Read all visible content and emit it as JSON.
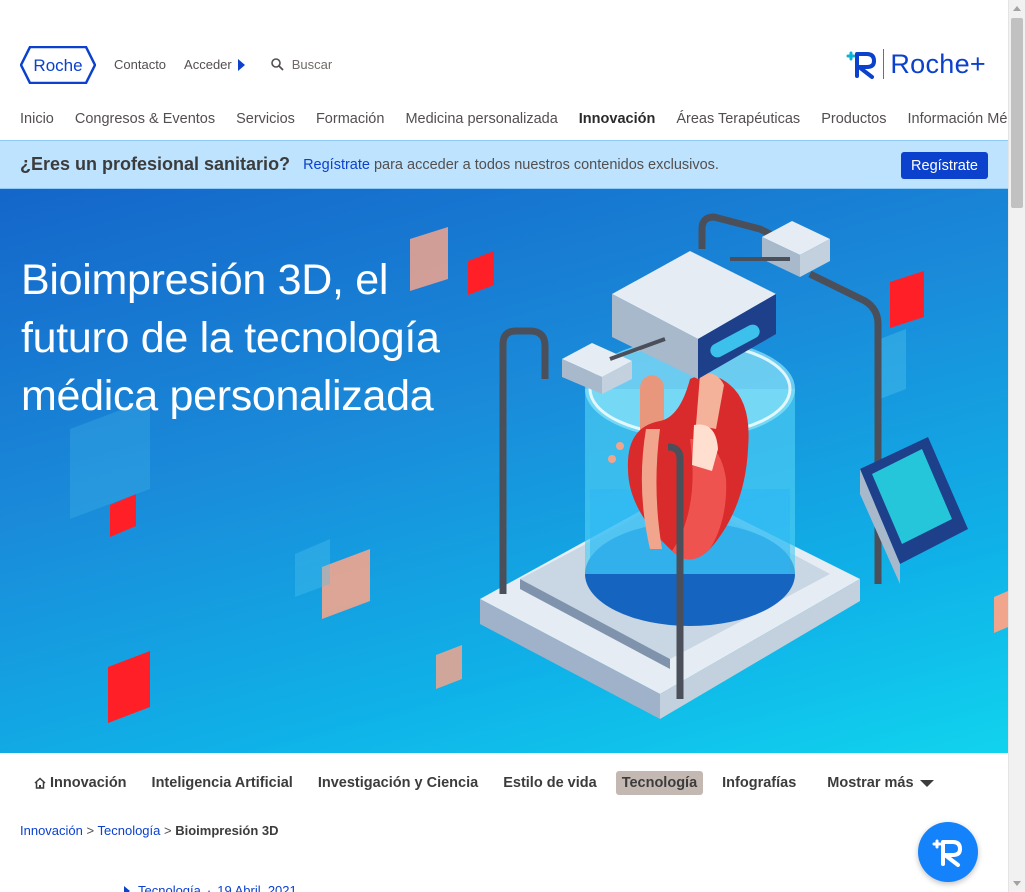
{
  "header": {
    "logo_text": "Roche",
    "links": {
      "contact": "Contacto",
      "login": "Acceder",
      "search": "Buscar"
    },
    "rocheplus_text": "Roche+"
  },
  "mainnav": [
    "Inicio",
    "Congresos & Eventos",
    "Servicios",
    "Formación",
    "Medicina personalizada",
    "Innovación",
    "Áreas Terapéuticas",
    "Productos",
    "Información Médica"
  ],
  "mainnav_active": "Innovación",
  "banner": {
    "question": "¿Eres un profesional sanitario?",
    "link": "Regístrate",
    "rest": "para acceder a todos nuestros contenidos exclusivos.",
    "button": "Regístrate"
  },
  "hero": {
    "title": "Bioimpresión 3D, el futuro de la tecnología médica personalizada"
  },
  "subnav": {
    "items": [
      "Innovación",
      "Inteligencia Artificial",
      "Investigación y Ciencia",
      "Estilo de vida",
      "Tecnología",
      "Infografías"
    ],
    "active": "Tecnología",
    "more": "Mostrar más"
  },
  "breadcrumb": {
    "innovacion": "Innovación",
    "sep1": ">",
    "tecnologia": "Tecnología",
    "sep2": ">",
    "current": "Bioimpresión 3D"
  },
  "meta": {
    "category": "Tecnología",
    "date": "19 Abril, 2021"
  },
  "colors": {
    "brand_blue": "#0b41cd",
    "banner_bg": "#bde3ff",
    "accent_red": "#ff1f26",
    "hero_blue": "#1a8ad9"
  },
  "icons": [
    "roche-logo",
    "chevron-right-icon",
    "search-icon",
    "rocheplus-logo",
    "home-icon",
    "chevron-down-icon",
    "rocheplus-chat-icon"
  ]
}
